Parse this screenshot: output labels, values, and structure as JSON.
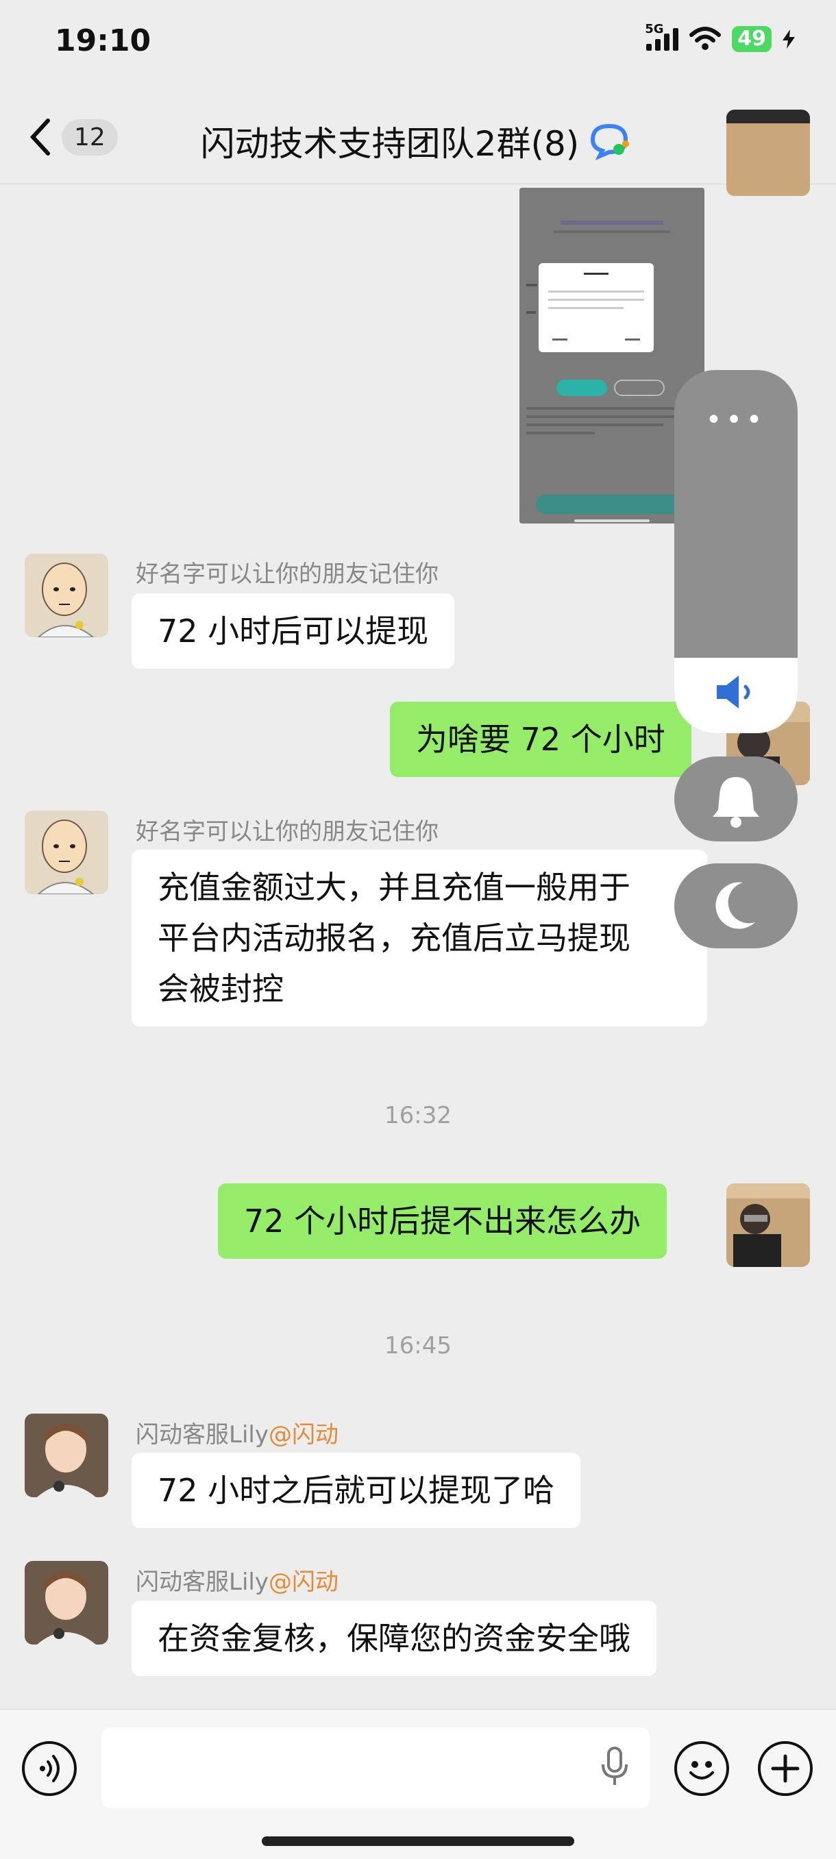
{
  "status": {
    "time": "19:10",
    "network": "5G",
    "battery": "49"
  },
  "header": {
    "back_count": "12",
    "title": "闪动技术支持团队2群(8)"
  },
  "messages": [
    {
      "sender": "好名字可以让你的朋友记住你",
      "text": "72 小时后可以提现"
    },
    {
      "text": "为啥要 72 个小时"
    },
    {
      "sender": "好名字可以让你的朋友记住你",
      "lines": [
        "充值金额过大，并且充值一般用于",
        "平台内活动报名，充值后立马提现",
        "会被封控"
      ]
    },
    {
      "time": "16:32"
    },
    {
      "text": "72 个小时后提不出来怎么办"
    },
    {
      "time": "16:45"
    },
    {
      "sender": "闪动客服Lily",
      "mention": "@闪动",
      "text": "72 小时之后就可以提现了哈"
    },
    {
      "sender": "闪动客服Lily",
      "mention": "@闪动",
      "text": "在资金复核，保障您的资金安全哦"
    }
  ],
  "colors": {
    "outgoing_bubble": "#95ec69",
    "incoming_bubble": "#ffffff",
    "mention": "#e58b35",
    "background": "#ededed"
  },
  "icons": [
    "back-icon",
    "ai-assistant-icon",
    "more-icon",
    "voice-icon",
    "mic-icon",
    "emoji-icon",
    "plus-icon",
    "speaker-icon",
    "bell-icon",
    "moon-icon"
  ]
}
